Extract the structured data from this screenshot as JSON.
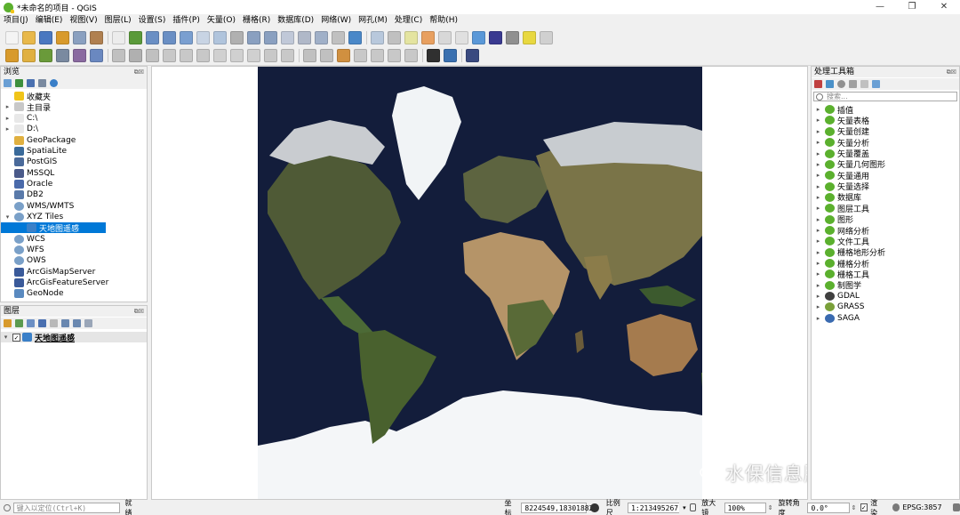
{
  "window": {
    "title": "*未命名的项目 - QGIS",
    "controls": [
      "—",
      "❐",
      "✕"
    ]
  },
  "menu": [
    "项目(J)",
    "编辑(E)",
    "视图(V)",
    "图层(L)",
    "设置(S)",
    "插件(P)",
    "矢量(O)",
    "栅格(R)",
    "数据库(D)",
    "网络(W)",
    "网孔(M)",
    "处理(C)",
    "帮助(H)"
  ],
  "browser": {
    "title": "浏览",
    "items": [
      {
        "label": "收藏夹",
        "icon": "star-icon",
        "expand": "",
        "depth": 0
      },
      {
        "label": "主目录",
        "icon": "home-folder-icon",
        "expand": "▸",
        "depth": 0
      },
      {
        "label": "C:\\",
        "icon": "drive-icon",
        "expand": "▸",
        "depth": 0
      },
      {
        "label": "D:\\",
        "icon": "drive-icon",
        "expand": "▸",
        "depth": 0
      },
      {
        "label": "GeoPackage",
        "icon": "geopackage-icon",
        "expand": "",
        "depth": 0
      },
      {
        "label": "SpatiaLite",
        "icon": "spatialite-icon",
        "expand": "",
        "depth": 0
      },
      {
        "label": "PostGIS",
        "icon": "postgis-icon",
        "expand": "",
        "depth": 0
      },
      {
        "label": "MSSQL",
        "icon": "mssql-icon",
        "expand": "",
        "depth": 0
      },
      {
        "label": "Oracle",
        "icon": "oracle-icon",
        "expand": "",
        "depth": 0
      },
      {
        "label": "DB2",
        "icon": "db2-icon",
        "expand": "",
        "depth": 0
      },
      {
        "label": "WMS/WMTS",
        "icon": "globe-icon",
        "expand": "",
        "depth": 0
      },
      {
        "label": "XYZ Tiles",
        "icon": "globe-icon",
        "expand": "▾",
        "depth": 0
      },
      {
        "label": "天地图遥感",
        "icon": "tiles-icon",
        "expand": "",
        "depth": 1,
        "selected": true
      },
      {
        "label": "WCS",
        "icon": "globe-icon",
        "expand": "",
        "depth": 0
      },
      {
        "label": "WFS",
        "icon": "globe-icon",
        "expand": "",
        "depth": 0
      },
      {
        "label": "OWS",
        "icon": "globe-icon",
        "expand": "",
        "depth": 0
      },
      {
        "label": "ArcGisMapServer",
        "icon": "arcgis-icon",
        "expand": "",
        "depth": 0
      },
      {
        "label": "ArcGisFeatureServer",
        "icon": "arcgis-icon",
        "expand": "",
        "depth": 0
      },
      {
        "label": "GeoNode",
        "icon": "geonode-icon",
        "expand": "",
        "depth": 0
      }
    ]
  },
  "layers": {
    "title": "图层",
    "items": [
      {
        "label": "天地图遥感",
        "checked": "✓",
        "expand": "▾"
      }
    ]
  },
  "toolbox": {
    "title": "处理工具箱",
    "search_placeholder": "搜索...",
    "items": [
      {
        "label": "插值",
        "icon": "qgis-icon"
      },
      {
        "label": "矢量表格",
        "icon": "qgis-icon"
      },
      {
        "label": "矢量创建",
        "icon": "qgis-icon"
      },
      {
        "label": "矢量分析",
        "icon": "qgis-icon"
      },
      {
        "label": "矢量覆盖",
        "icon": "qgis-icon"
      },
      {
        "label": "矢量几何图形",
        "icon": "qgis-icon"
      },
      {
        "label": "矢量通用",
        "icon": "qgis-icon"
      },
      {
        "label": "矢量选择",
        "icon": "qgis-icon"
      },
      {
        "label": "数据库",
        "icon": "qgis-icon"
      },
      {
        "label": "图层工具",
        "icon": "qgis-icon"
      },
      {
        "label": "图形",
        "icon": "qgis-icon"
      },
      {
        "label": "网络分析",
        "icon": "qgis-icon"
      },
      {
        "label": "文件工具",
        "icon": "qgis-icon"
      },
      {
        "label": "栅格地形分析",
        "icon": "qgis-icon"
      },
      {
        "label": "栅格分析",
        "icon": "qgis-icon"
      },
      {
        "label": "栅格工具",
        "icon": "qgis-icon"
      },
      {
        "label": "制图学",
        "icon": "qgis-icon"
      },
      {
        "label": "GDAL",
        "icon": "gdal-icon"
      },
      {
        "label": "GRASS",
        "icon": "grass-icon"
      },
      {
        "label": "SAGA",
        "icon": "saga-icon"
      }
    ]
  },
  "status": {
    "locator_placeholder": "键入以定位(Ctrl+K)",
    "ready": "就绪",
    "coord_label": "坐标",
    "coord_value": "8224549,18301882",
    "scale_label": "比例尺",
    "scale_value": "1:213495267",
    "magnifier_label": "放大镜",
    "magnifier_value": "100%",
    "rotation_label": "旋转角度",
    "rotation_value": "0.0°",
    "render_label": "渲染",
    "render_checked": "✓",
    "crs": "EPSG:3857"
  },
  "watermark": "水保信息服务平台",
  "colors": {
    "accent": "#0078d7",
    "ocean": "#131d3b",
    "ice": "#f3f6f8"
  }
}
